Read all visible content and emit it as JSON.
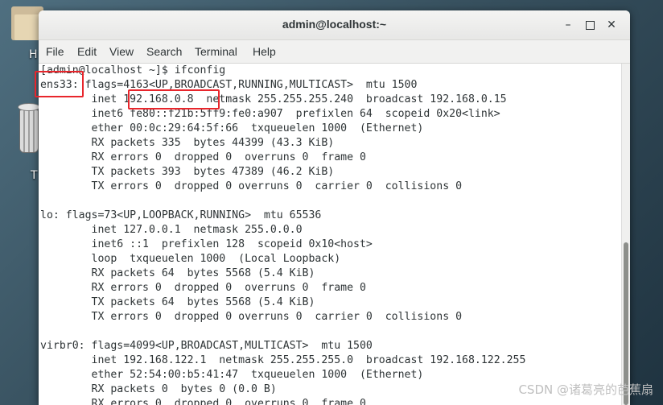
{
  "desktop": {
    "home_label": "H",
    "trash_label": "T"
  },
  "window": {
    "title": "admin@localhost:~",
    "controls": {
      "minimize": "–",
      "maximize": "",
      "close": "✕"
    }
  },
  "menubar": {
    "items": [
      "File",
      "Edit",
      "View",
      "Search",
      "Terminal",
      "Help"
    ]
  },
  "terminal": {
    "lines": [
      "[admin@localhost ~]$ ifconfig",
      "ens33: flags=4163<UP,BROADCAST,RUNNING,MULTICAST>  mtu 1500",
      "        inet 192.168.0.8  netmask 255.255.255.240  broadcast 192.168.0.15",
      "        inet6 fe80::f21b:5ff9:fe0:a907  prefixlen 64  scopeid 0x20<link>",
      "        ether 00:0c:29:64:5f:66  txqueuelen 1000  (Ethernet)",
      "        RX packets 335  bytes 44399 (43.3 KiB)",
      "        RX errors 0  dropped 0  overruns 0  frame 0",
      "        TX packets 393  bytes 47389 (46.2 KiB)",
      "        TX errors 0  dropped 0 overruns 0  carrier 0  collisions 0",
      "",
      "lo: flags=73<UP,LOOPBACK,RUNNING>  mtu 65536",
      "        inet 127.0.0.1  netmask 255.0.0.0",
      "        inet6 ::1  prefixlen 128  scopeid 0x10<host>",
      "        loop  txqueuelen 1000  (Local Loopback)",
      "        RX packets 64  bytes 5568 (5.4 KiB)",
      "        RX errors 0  dropped 0  overruns 0  frame 0",
      "        TX packets 64  bytes 5568 (5.4 KiB)",
      "        TX errors 0  dropped 0 overruns 0  carrier 0  collisions 0",
      "",
      "virbr0: flags=4099<UP,BROADCAST,MULTICAST>  mtu 1500",
      "        inet 192.168.122.1  netmask 255.255.255.0  broadcast 192.168.122.255",
      "        ether 52:54:00:b5:41:47  txqueuelen 1000  (Ethernet)",
      "        RX packets 0  bytes 0 (0.0 B)",
      "        RX errors 0  dropped 0  overruns 0  frame 0"
    ]
  },
  "watermark": "CSDN @诸葛亮的芭蕉扇",
  "colors": {
    "highlight_box": "#e8262c",
    "terminal_text": "#2e3436"
  }
}
